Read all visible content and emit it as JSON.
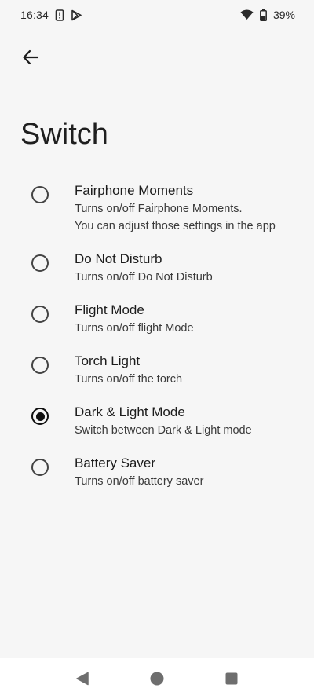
{
  "status_bar": {
    "time": "16:34",
    "battery_percent": "39%",
    "icons": [
      "phone-alert-icon",
      "play-store-icon",
      "wifi-icon",
      "battery-icon"
    ]
  },
  "header": {
    "title": "Switch"
  },
  "options": [
    {
      "title": "Fairphone Moments",
      "description": "Turns on/off Fairphone Moments.\nYou can adjust those settings in the app",
      "selected": false
    },
    {
      "title": "Do Not Disturb",
      "description": "Turns on/off Do Not Disturb",
      "selected": false
    },
    {
      "title": "Flight Mode",
      "description": "Turns on/off flight Mode",
      "selected": false
    },
    {
      "title": "Torch Light",
      "description": "Turns on/off the torch",
      "selected": false
    },
    {
      "title": "Dark & Light Mode",
      "description": "Switch between Dark & Light mode",
      "selected": true
    },
    {
      "title": "Battery Saver",
      "description": "Turns on/off battery saver",
      "selected": false
    }
  ],
  "nav_bar": {
    "icons": [
      "back-triangle-icon",
      "home-circle-icon",
      "recents-square-icon"
    ]
  }
}
